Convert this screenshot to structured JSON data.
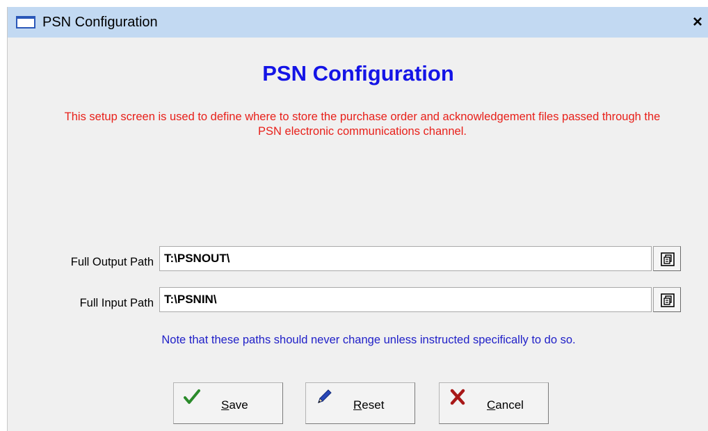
{
  "window": {
    "title": "PSN Configuration",
    "close_label": "×"
  },
  "main": {
    "heading": "PSN Configuration",
    "description": "This setup screen is used to define where to store the purchase order and acknowledgement files passed through the PSN electronic communications channel.",
    "note": "Note that these paths should never change unless instructed specifically to do so."
  },
  "fields": {
    "output": {
      "label": "Full Output Path",
      "value": "T:\\PSNOUT\\"
    },
    "input": {
      "label": "Full Input Path",
      "value": "T:\\PSNIN\\"
    }
  },
  "buttons": {
    "save": {
      "mnemonic": "S",
      "rest": "ave",
      "icon": "checkmark-icon"
    },
    "reset": {
      "mnemonic": "R",
      "rest": "eset",
      "icon": "pencil-icon"
    },
    "cancel": {
      "mnemonic": "C",
      "rest": "ancel",
      "icon": "x-mark-icon"
    }
  },
  "colors": {
    "titlebar": "#c2d9f2",
    "heading": "#1414e6",
    "description": "#e8201a",
    "note": "#2020c8",
    "window_bg": "#f0f0f0"
  }
}
